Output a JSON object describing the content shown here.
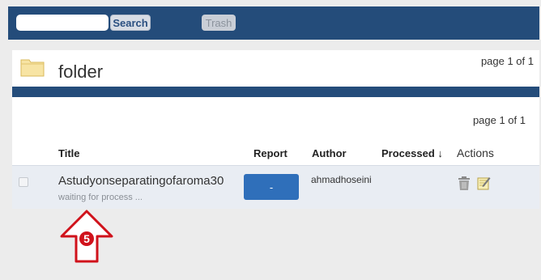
{
  "header": {
    "search_placeholder": "",
    "search_label": "Search",
    "trash_label": "Trash"
  },
  "folder": {
    "title": "folder",
    "page_top": "page 1 of 1",
    "page_mid": "page 1 of 1"
  },
  "table": {
    "columns": {
      "title": "Title",
      "report": "Report",
      "author": "Author",
      "processed": "Processed ↓",
      "actions": "Actions"
    },
    "rows": [
      {
        "title": "Astudyonseparatingofaroma30",
        "status": "waiting for process ...",
        "report": "-",
        "author": "ahmadhoseini",
        "processed": ""
      }
    ]
  },
  "annotation": {
    "number": "5",
    "color": "#d0121b"
  },
  "colors": {
    "header_bg": "#244c7a",
    "report_button": "#2f6fba",
    "row_bg": "#e9edf3"
  },
  "icons": [
    "folder-icon",
    "trash-icon",
    "edit-icon",
    "arrow-up-icon"
  ]
}
